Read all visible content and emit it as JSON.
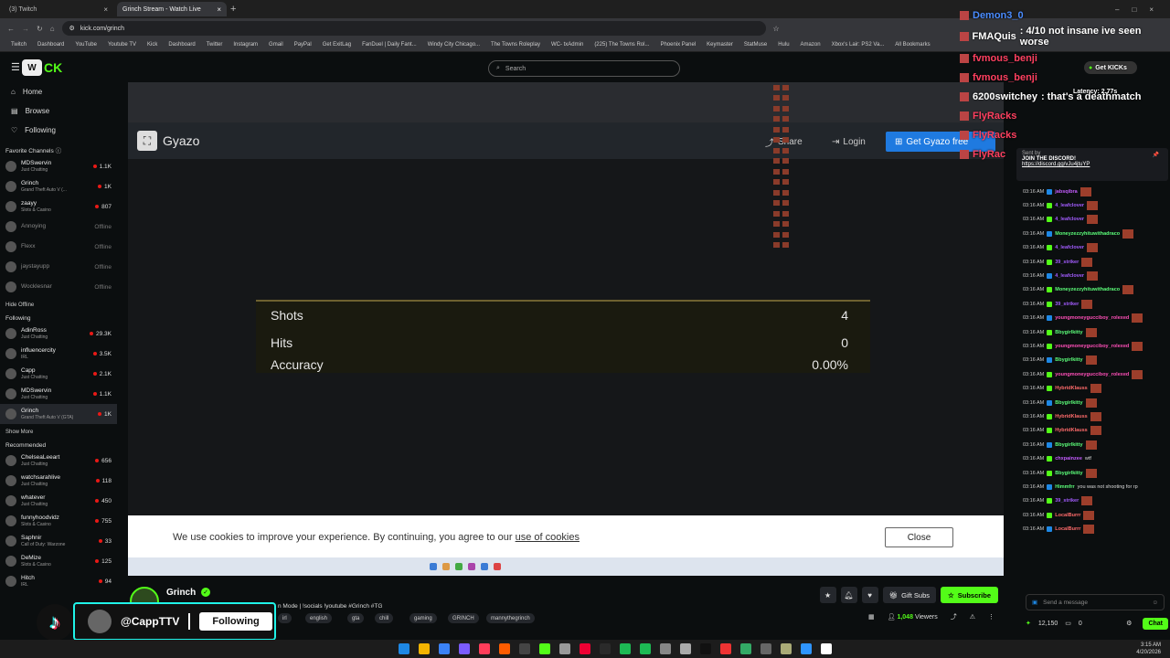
{
  "browser": {
    "tabs": [
      {
        "label": "(3) Twitch",
        "active": false
      },
      {
        "label": "Grinch Stream - Watch Live",
        "active": true
      }
    ],
    "url": "kick.com/grinch",
    "bookmarks": [
      "Twitch",
      "Dashboard",
      "YouTube",
      "Youtube TV",
      "Kick",
      "Dashboard",
      "Twitter",
      "Instagram",
      "Gmail",
      "PayPal",
      "Get ExitLag",
      "FanDuel | Daily Fant...",
      "Windy City Chicago...",
      "The Towns Roleplay",
      "WC- txAdmin",
      "(225) The Towns Rol...",
      "Phoenix Panel",
      "Keymaster",
      "StatMuse",
      "Hulu",
      "Amazon",
      "Xbox's Lair: PS2 Va...",
      "All Bookmarks"
    ]
  },
  "kick": {
    "search_placeholder": "Search",
    "nav": [
      {
        "label": "Home",
        "icon": "home-icon"
      },
      {
        "label": "Browse",
        "icon": "browse-icon"
      },
      {
        "label": "Following",
        "icon": "heart-icon"
      }
    ],
    "favorite_title": "Favorite Channels",
    "favorites": [
      {
        "name": "MDSwervin",
        "game": "Just Chatting",
        "viewers": "1.1K",
        "live": true
      },
      {
        "name": "Grinch",
        "game": "Grand Theft Auto V (...",
        "viewers": "1K",
        "live": true
      },
      {
        "name": "zaayy",
        "game": "Slots & Casino",
        "viewers": "807",
        "live": true
      },
      {
        "name": "Annoying",
        "game": "",
        "viewers": "Offline",
        "live": false
      },
      {
        "name": "Flexx",
        "game": "",
        "viewers": "Offline",
        "live": false
      },
      {
        "name": "jaystayupp",
        "game": "",
        "viewers": "Offline",
        "live": false
      },
      {
        "name": "Wocklesnar",
        "game": "",
        "viewers": "Offline",
        "live": false
      }
    ],
    "hide_offline": "Hide Offline",
    "following_title": "Following",
    "following": [
      {
        "name": "AdinRoss",
        "game": "Just Chatting",
        "viewers": "29.3K"
      },
      {
        "name": "influencercity",
        "game": "IRL",
        "viewers": "3.5K"
      },
      {
        "name": "Capp",
        "game": "Just Chatting",
        "viewers": "2.1K"
      },
      {
        "name": "MDSwervin",
        "game": "Just Chatting",
        "viewers": "1.1K"
      },
      {
        "name": "Grinch",
        "game": "Grand Theft Auto V (GTA)",
        "viewers": "1K"
      }
    ],
    "show_more": "Show More",
    "recommended_title": "Recommended",
    "recommended": [
      {
        "name": "ChelseaLeeart",
        "game": "Just Chatting",
        "viewers": "656"
      },
      {
        "name": "watchsarahlive",
        "game": "Just Chatting",
        "viewers": "118"
      },
      {
        "name": "whatever",
        "game": "Just Chatting",
        "viewers": "450"
      },
      {
        "name": "funnyhoodvidz",
        "game": "Slots & Casino",
        "viewers": "755"
      },
      {
        "name": "Saphnir",
        "game": "Call of Duty: Warzone",
        "viewers": "33"
      },
      {
        "name": "DeMize",
        "game": "Slots & Casino",
        "viewers": "125"
      },
      {
        "name": "Hitch",
        "game": "IRL",
        "viewers": "94"
      }
    ]
  },
  "player": {
    "gyazo_logo": "Gyazo",
    "share": "Share",
    "login": "Login",
    "get_gyazo": "Get Gyazo free",
    "stats": [
      {
        "label": "Shots",
        "value": "4"
      },
      {
        "label": "Hits",
        "value": "0"
      },
      {
        "label": "Accuracy",
        "value": "0.00%"
      }
    ],
    "cookie_text": "We use cookies to improve your experience. By continuing, you agree to our ",
    "cookie_link": "use of cookies",
    "close": "Close"
  },
  "overlay_chat": [
    {
      "name": "Demon3_0",
      "msg": "",
      "color": "#4a8cff"
    },
    {
      "name": "FMAQuis",
      "msg": ": 4/10 not insane ive seen worse",
      "color": "#ffffff"
    },
    {
      "name": "fvmous_benji",
      "msg": "",
      "color": "#ff4060"
    },
    {
      "name": "fvmous_benji",
      "msg": "",
      "color": "#ff4060"
    },
    {
      "name": "6200switchey",
      "msg": ": that's a deathmatch",
      "color": "#ffffff"
    },
    {
      "name": "FlyRacks",
      "msg": "",
      "color": "#ff4060"
    },
    {
      "name": "FlyRacks",
      "msg": "",
      "color": "#ff4060"
    },
    {
      "name": "FlyRacks",
      "msg": "",
      "color": "#ff4060"
    }
  ],
  "overlay_extra": {
    "kicks": "Get KICKs",
    "latency": "Latency: 2.77s"
  },
  "chat": {
    "pinned_label": "Sent by",
    "pinned_msg": "JOIN THE DISCORD!",
    "pinned_link": "https://discord.gg/vJu4jtuYP",
    "messages": [
      {
        "time": "03:16 AM",
        "user": "jabsqibra",
        "color": "#c45cff",
        "msg": ""
      },
      {
        "time": "03:16 AM",
        "user": "4_leafclover",
        "color": "#a35cff",
        "msg": ""
      },
      {
        "time": "03:16 AM",
        "user": "4_leafclover",
        "color": "#a35cff",
        "msg": ""
      },
      {
        "time": "03:16 AM",
        "user": "Moneyzezzyhituwithadraco",
        "color": "#5cff7a",
        "msg": ""
      },
      {
        "time": "03:16 AM",
        "user": "4_leafclover",
        "color": "#a35cff",
        "msg": ""
      },
      {
        "time": "03:16 AM",
        "user": "39_striker",
        "color": "#a35cff",
        "msg": ""
      },
      {
        "time": "03:16 AM",
        "user": "4_leafclover",
        "color": "#a35cff",
        "msg": ""
      },
      {
        "time": "03:16 AM",
        "user": "Moneyzezzyhituwithadraco",
        "color": "#5cff7a",
        "msg": ""
      },
      {
        "time": "03:16 AM",
        "user": "39_striker",
        "color": "#a35cff",
        "msg": ""
      },
      {
        "time": "03:16 AM",
        "user": "youngmoneygucciboy_rolexed",
        "color": "#ff4fb8",
        "msg": ""
      },
      {
        "time": "03:16 AM",
        "user": "Bbygirlkitty",
        "color": "#5cff7a",
        "msg": ""
      },
      {
        "time": "03:16 AM",
        "user": "youngmoneygucciboy_rolexed",
        "color": "#ff4fb8",
        "msg": ""
      },
      {
        "time": "03:16 AM",
        "user": "Bbygirlkitty",
        "color": "#5cff7a",
        "msg": ""
      },
      {
        "time": "03:16 AM",
        "user": "youngmoneygucciboy_rolexed",
        "color": "#ff4fb8",
        "msg": ""
      },
      {
        "time": "03:16 AM",
        "user": "HybridKlauss",
        "color": "#ff6b6b",
        "msg": ""
      },
      {
        "time": "03:16 AM",
        "user": "Bbygirlkitty",
        "color": "#5cff7a",
        "msg": ""
      },
      {
        "time": "03:16 AM",
        "user": "HybridKlauss",
        "color": "#ff6b6b",
        "msg": ""
      },
      {
        "time": "03:16 AM",
        "user": "HybridKlauss",
        "color": "#ff6b6b",
        "msg": ""
      },
      {
        "time": "03:16 AM",
        "user": "Bbygirlkitty",
        "color": "#5cff7a",
        "msg": ""
      },
      {
        "time": "03:16 AM",
        "user": "chxpainzee",
        "color": "#c45cff",
        "msg": "wtf"
      },
      {
        "time": "03:16 AM",
        "user": "Bbygirlkitty",
        "color": "#5cff7a",
        "msg": ""
      },
      {
        "time": "03:16 AM",
        "user": "Himmfrr",
        "color": "#5cff7a",
        "msg": "you was not shooting for rp"
      },
      {
        "time": "03:16 AM",
        "user": "39_striker",
        "color": "#a35cff",
        "msg": ""
      },
      {
        "time": "03:16 AM",
        "user": "LocalBurrr",
        "color": "#ff6b6b",
        "msg": ""
      },
      {
        "time": "03:16 AM",
        "user": "LocalBurrr",
        "color": "#ff6b6b",
        "msg": ""
      }
    ],
    "input_placeholder": "Send a message",
    "points": "12,150",
    "zero": "0",
    "chat_button": "Chat"
  },
  "stream": {
    "name": "Grinch",
    "title": "n Mode | !socials !youtube #Grinch #TG",
    "tags": [
      "irl",
      "english",
      "gta",
      "chill",
      "gaming",
      "GRINCH",
      "mannythegrinch"
    ],
    "gift_subs": "Gift Subs",
    "subscribe": "Subscribe",
    "viewers": "1,048",
    "viewers_label": "Viewers"
  },
  "tiktok": {
    "handle": "@CappTTV",
    "follow": "Following"
  },
  "clock": {
    "time": "3:15 AM",
    "date": "4/20/2026"
  }
}
